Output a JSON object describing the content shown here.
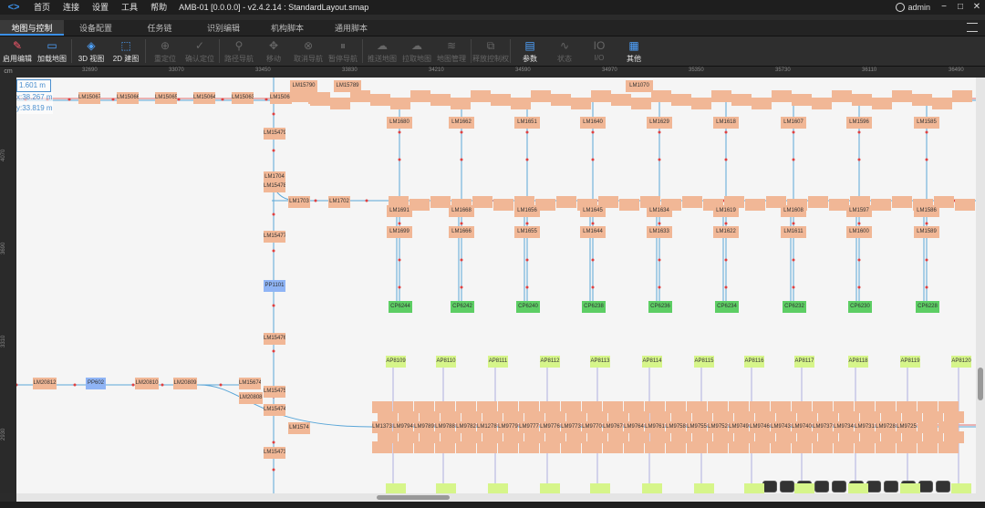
{
  "app": {
    "menu": [
      "首页",
      "连接",
      "设置",
      "工具",
      "帮助"
    ],
    "window_title": "AMB-01 [0.0.0.0] - v2.4.2.14 : StandardLayout.smap",
    "user": "admin",
    "window_buttons": [
      "−",
      "□",
      "✕"
    ]
  },
  "tabs": [
    {
      "label": "地图与控制",
      "active": true
    },
    {
      "label": "设备配置"
    },
    {
      "label": "任务链"
    },
    {
      "label": "识别编辑"
    },
    {
      "label": "机构脚本"
    },
    {
      "label": "通用脚本"
    }
  ],
  "toolbar": [
    {
      "label": "启用编辑",
      "icon": "pen-icon",
      "glyph": "✎",
      "state": "on"
    },
    {
      "label": "加载地图",
      "icon": "folder-icon",
      "glyph": "▭",
      "state": "on"
    },
    {
      "label": "3D 视图",
      "icon": "cube-icon",
      "glyph": "◈",
      "state": "on"
    },
    {
      "label": "2D 建图",
      "icon": "map-icon",
      "glyph": "⬚",
      "state": "on"
    },
    {
      "label": "重定位",
      "icon": "crosshair-icon",
      "glyph": "⊕",
      "state": "off"
    },
    {
      "label": "确认定位",
      "icon": "check-circle-icon",
      "glyph": "✓",
      "state": "off"
    },
    {
      "label": "路径导航",
      "icon": "pin-icon",
      "glyph": "⚲",
      "state": "off"
    },
    {
      "label": "移动",
      "icon": "move-icon",
      "glyph": "✥",
      "state": "off"
    },
    {
      "label": "取消导航",
      "icon": "cancel-icon",
      "glyph": "⊗",
      "state": "off"
    },
    {
      "label": "暂停导航",
      "icon": "pause-icon",
      "glyph": "⏸",
      "state": "off"
    },
    {
      "label": "推送地图",
      "icon": "cloud-upload-icon",
      "glyph": "☁",
      "state": "off"
    },
    {
      "label": "拉取地图",
      "icon": "cloud-download-icon",
      "glyph": "☁",
      "state": "off"
    },
    {
      "label": "地图管理",
      "icon": "layers-icon",
      "glyph": "≋",
      "state": "off"
    },
    {
      "label": "释放控制权",
      "icon": "control-icon",
      "glyph": "⧉",
      "state": "off"
    },
    {
      "label": "参数",
      "icon": "params-icon",
      "glyph": "▤",
      "state": "on"
    },
    {
      "label": "状态",
      "icon": "chart-icon",
      "glyph": "∿",
      "state": "off"
    },
    {
      "label": "I/O",
      "icon": "io-icon",
      "glyph": "IO",
      "state": "off"
    },
    {
      "label": "其他",
      "icon": "grid-icon",
      "glyph": "▦",
      "state": "on"
    }
  ],
  "ruler": {
    "unit": "cm",
    "top_ticks": [
      "32690",
      "33070",
      "33450",
      "33830",
      "34210",
      "34590",
      "34970",
      "35350",
      "35730",
      "36110",
      "36490"
    ],
    "left_ticks": [
      "4070",
      "3690",
      "3310",
      "2930"
    ]
  },
  "canvas_info": {
    "scale": "1.601 m",
    "x": "x:38.267 m",
    "y": "y:33.819 m"
  },
  "nodes": {
    "row1_left": [
      "LM15067",
      "LM15066",
      "LM15065",
      "LM15064",
      "LM15063",
      "LM15062",
      "LM15061"
    ],
    "top_labels": [
      "LM15790",
      "LM15789",
      "LM1070"
    ],
    "column_tops": [
      "LM1680",
      "LM1662",
      "LM1651",
      "LM1640",
      "LM1629",
      "LM1618",
      "LM1607",
      "LM1596",
      "LM1585"
    ],
    "mid_left": [
      "LM15479",
      "LM1704",
      "LM15478",
      "LM1703",
      "LM1702",
      "LM15477"
    ],
    "column_mids": [
      "LM1691",
      "LM1668",
      "LM1656",
      "LM1645",
      "LM1634",
      "LM1619",
      "LM1608",
      "LM1597",
      "LM1586"
    ],
    "column_lows": [
      "LM1699",
      "LM1666",
      "LM1655",
      "LM1644",
      "LM1633",
      "LM1622",
      "LM1611",
      "LM1600",
      "LM1589"
    ],
    "pp_center": "PP1101",
    "cp": [
      "CP6244",
      "CP6242",
      "CP6240",
      "CP6238",
      "CP6236",
      "CP6234",
      "CP6232",
      "CP6230",
      "CP6228"
    ],
    "lower_left": [
      "LM15476",
      "LM15475",
      "LM15474",
      "LM15473",
      "LM1574"
    ],
    "row_left": [
      "LM20812",
      "PP602",
      "LM20810",
      "LM20809",
      "LM15674",
      "LM20808"
    ],
    "ap": [
      "AP8109",
      "AP8110",
      "AP8111",
      "AP8112",
      "AP8113",
      "AP8114",
      "AP8115",
      "AP8116",
      "AP8117",
      "AP8118",
      "AP8119",
      "AP8120"
    ],
    "dense_labels": [
      "LM1373",
      "LM9794",
      "LM9789",
      "LM9788",
      "LM9782",
      "LM12781",
      "LM9779",
      "LM9777",
      "LM9776",
      "LM9773",
      "LM9770",
      "LM9767",
      "LM9764",
      "LM9761",
      "LM9758",
      "LM9755",
      "LM9752",
      "LM9749",
      "LM9746",
      "LM9743",
      "LM9740",
      "LM9737",
      "LM9734",
      "LM9731",
      "LM9728",
      "LM9725"
    ]
  }
}
